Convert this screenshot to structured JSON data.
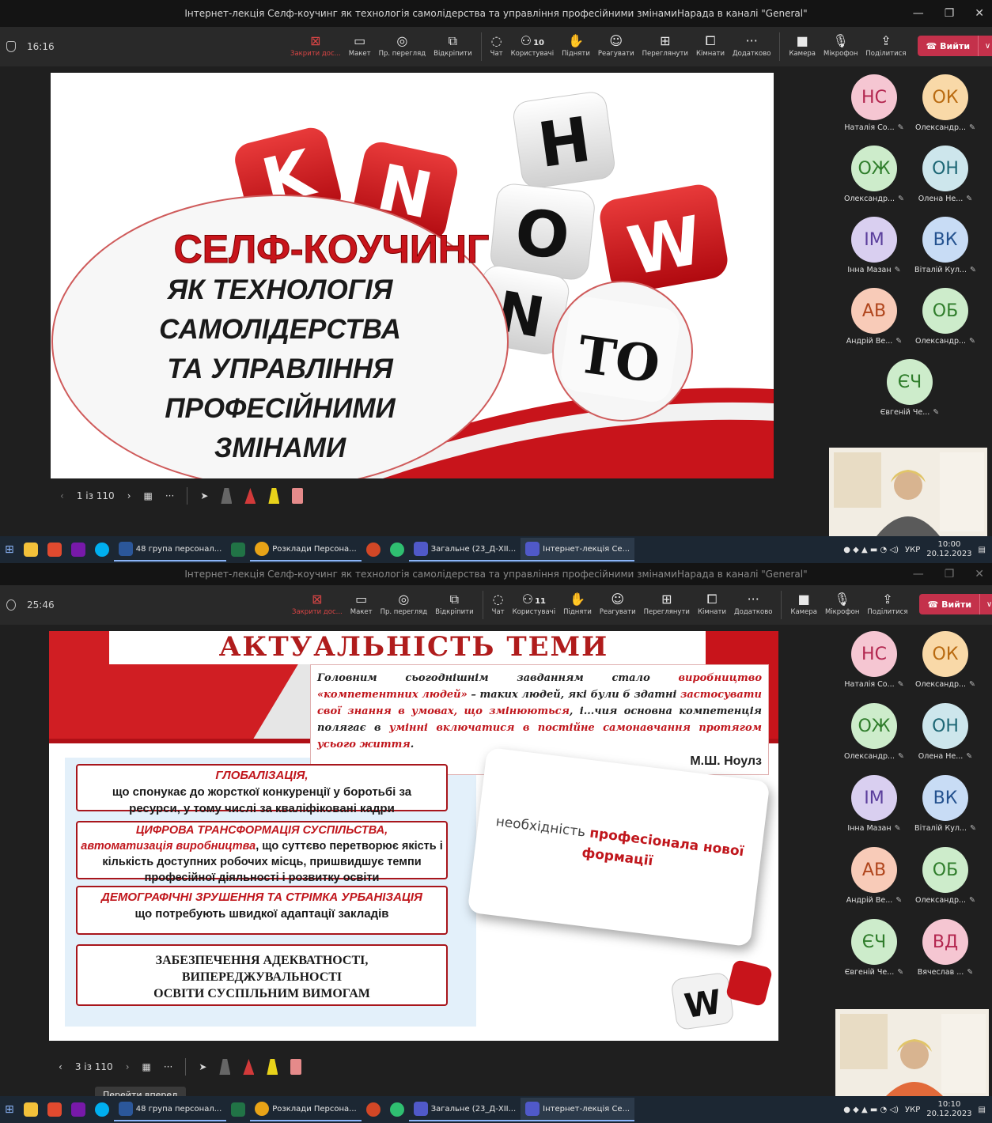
{
  "screens": [
    {
      "window": {
        "title": "Інтернет-лекція Селф-коучинг як технологія самолідерства та управління професійними змінамиНарада в каналі \"General\""
      },
      "meeting": {
        "elapsed": "16:16",
        "toolbar": [
          {
            "label": "Закрити дос...",
            "icon": "close-share-icon",
            "active": true
          },
          {
            "label": "Макет",
            "icon": "layout-icon"
          },
          {
            "label": "Пр. перегляд",
            "icon": "eye-icon"
          },
          {
            "label": "Відкріпити",
            "icon": "popout-icon"
          },
          {
            "label": "Чат",
            "icon": "chat-icon"
          },
          {
            "label": "Користувачі",
            "icon": "people-icon",
            "count": "10"
          },
          {
            "label": "Підняти",
            "icon": "hand-icon"
          },
          {
            "label": "Реагувати",
            "icon": "smile-icon"
          },
          {
            "label": "Переглянути",
            "icon": "view-icon"
          },
          {
            "label": "Кімнати",
            "icon": "rooms-icon"
          },
          {
            "label": "Додатково",
            "icon": "more-icon"
          },
          {
            "label": "Камера",
            "icon": "camera-icon"
          },
          {
            "label": "Мікрофон",
            "icon": "mic-icon"
          },
          {
            "label": "Поділитися",
            "icon": "share-icon"
          }
        ],
        "leave_label": "Вийти",
        "slide_counter": "1 із 110"
      },
      "slide": {
        "dice_letters": [
          "K",
          "N",
          "O",
          "H",
          "O",
          "W",
          "N",
          "TO"
        ],
        "title_red": "СЕЛФ-КОУЧИНГ",
        "title_lines": [
          "ЯК ТЕХНОЛОГІЯ",
          "САМОЛІДЕРСТВА",
          "ТА УПРАВЛІННЯ",
          "ПРОФЕСІЙНИМИ",
          "ЗМІНАМИ"
        ]
      },
      "participants": [
        {
          "initials": "НС",
          "name": "Наталія Со...",
          "bg": "#f5c6d2",
          "fg": "#b3264f"
        },
        {
          "initials": "ОК",
          "name": "Олександр...",
          "bg": "#f9d9a8",
          "fg": "#b96a10"
        },
        {
          "initials": "ОЖ",
          "name": "Олександр...",
          "bg": "#cdeccb",
          "fg": "#2f7d2b"
        },
        {
          "initials": "ОН",
          "name": "Олена Не...",
          "bg": "#cde6ec",
          "fg": "#1d6775"
        },
        {
          "initials": "ІМ",
          "name": "Інна Мазан",
          "bg": "#d9cff0",
          "fg": "#5a3e9c"
        },
        {
          "initials": "ВК",
          "name": "Віталій Кул...",
          "bg": "#c8dcf5",
          "fg": "#24528f"
        },
        {
          "initials": "АВ",
          "name": "Андрій Ве...",
          "bg": "#f8cbb8",
          "fg": "#b0451c"
        },
        {
          "initials": "ОБ",
          "name": "Олександр...",
          "bg": "#cdeccb",
          "fg": "#2f7d2b"
        },
        {
          "initials": "ЄЧ",
          "name": "Євгеній Че...",
          "bg": "#cdeccb",
          "fg": "#2f7d2b"
        }
      ],
      "taskbar": {
        "apps": [
          {
            "label": "48 група персонал...",
            "color": "#2b579a"
          },
          {
            "label": "Розклади Персона...",
            "color": "#e8a317"
          },
          {
            "label": "Загальне (23_Д-ХІІ...",
            "color": "#5059c9"
          },
          {
            "label": "Інтернет-лекція Се...",
            "color": "#5059c9"
          }
        ],
        "lang": "УКР",
        "time": "10:00",
        "date": "20.12.2023"
      }
    },
    {
      "window": {
        "title": "Інтернет-лекція Селф-коучинг як технологія самолідерства та управління професійними змінамиНарада в каналі \"General\""
      },
      "meeting": {
        "elapsed": "25:46",
        "toolbar": [
          {
            "label": "Закрити дос...",
            "icon": "close-share-icon",
            "active": true
          },
          {
            "label": "Макет",
            "icon": "layout-icon"
          },
          {
            "label": "Пр. перегляд",
            "icon": "eye-icon"
          },
          {
            "label": "Відкріпити",
            "icon": "popout-icon"
          },
          {
            "label": "Чат",
            "icon": "chat-icon"
          },
          {
            "label": "Користувачі",
            "icon": "people-icon",
            "count": "11"
          },
          {
            "label": "Підняти",
            "icon": "hand-icon"
          },
          {
            "label": "Реагувати",
            "icon": "smile-icon"
          },
          {
            "label": "Переглянути",
            "icon": "view-icon"
          },
          {
            "label": "Кімнати",
            "icon": "rooms-icon"
          },
          {
            "label": "Додатково",
            "icon": "more-icon"
          },
          {
            "label": "Камера",
            "icon": "camera-icon"
          },
          {
            "label": "Мікрофон",
            "icon": "mic-icon"
          },
          {
            "label": "Поділитися",
            "icon": "share-icon"
          }
        ],
        "leave_label": "Вийти",
        "slide_counter": "3 із 110",
        "tooltip": "Перейти вперед"
      },
      "slide": {
        "title": "АКТУАЛЬНІСТЬ  ТЕМИ",
        "quote_parts": [
          {
            "t": "Головним сьогоднішнім завданням стало ",
            "hl": false
          },
          {
            "t": "виробництво «компетентних людей»",
            "hl": true
          },
          {
            "t": " – таких людей, які були б здатні ",
            "hl": false
          },
          {
            "t": "застосувати свої знання в умовах, що змінюються",
            "hl": true
          },
          {
            "t": ", і...чия основна компетенція полягає в ",
            "hl": false
          },
          {
            "t": "умінні включатися в постійне самонавчання протягом усього життя",
            "hl": true
          },
          {
            "t": ".",
            "hl": false
          }
        ],
        "quote_author": "М.Ш. Ноулз",
        "box1_red": "ГЛОБАЛІЗАЦІЯ,",
        "box1_text": "що спонукає до жорсткої конкуренції у боротьбі за ресурси, у тому числі за кваліфіковані кадри",
        "box2_red1": "ЦИФРОВА ТРАНСФОРМАЦІЯ СУСПІЛЬСТВА,",
        "box2_red2": "автоматизація виробництва",
        "box2_text": ", що суттєво перетворює якість і кількість доступних робочих місць, пришвидшує темпи професійної діяльності і розвитку освіти",
        "box3_red": "ДЕМОГРАФІЧНІ ЗРУШЕННЯ ТА СТРІМКА УРБАНІЗАЦІЯ",
        "box3_text": "що потребують швидкої адаптації закладів",
        "box4_lines": [
          "ЗАБЕЗПЕЧЕННЯ АДЕКВАТНОСТІ,",
          "ВИПЕРЕДЖУВАЛЬНОСТІ",
          "ОСВІТИ СУСПІЛЬНИМ ВИМОГАМ"
        ],
        "card_plain": "необхідність ",
        "card_red": "професіонала нової формації",
        "dice_letter": "W"
      },
      "participants": [
        {
          "initials": "НС",
          "name": "Наталія Со...",
          "bg": "#f5c6d2",
          "fg": "#b3264f"
        },
        {
          "initials": "ОК",
          "name": "Олександр...",
          "bg": "#f9d9a8",
          "fg": "#b96a10"
        },
        {
          "initials": "ОЖ",
          "name": "Олександр...",
          "bg": "#cdeccb",
          "fg": "#2f7d2b"
        },
        {
          "initials": "ОН",
          "name": "Олена Не...",
          "bg": "#cde6ec",
          "fg": "#1d6775"
        },
        {
          "initials": "ІМ",
          "name": "Інна Мазан",
          "bg": "#d9cff0",
          "fg": "#5a3e9c"
        },
        {
          "initials": "ВК",
          "name": "Віталій Кул...",
          "bg": "#c8dcf5",
          "fg": "#24528f"
        },
        {
          "initials": "АВ",
          "name": "Андрій Ве...",
          "bg": "#f8cbb8",
          "fg": "#b0451c"
        },
        {
          "initials": "ОБ",
          "name": "Олександр...",
          "bg": "#cdeccb",
          "fg": "#2f7d2b"
        },
        {
          "initials": "ЄЧ",
          "name": "Євгеній Че...",
          "bg": "#cdeccb",
          "fg": "#2f7d2b"
        },
        {
          "initials": "ВД",
          "name": "Вячеслав ...",
          "bg": "#f5c6d2",
          "fg": "#b3264f"
        }
      ],
      "taskbar": {
        "apps": [
          {
            "label": "48 група персонал...",
            "color": "#2b579a"
          },
          {
            "label": "Розклади Персона...",
            "color": "#e8a317"
          },
          {
            "label": "Загальне (23_Д-ХІІ...",
            "color": "#5059c9"
          },
          {
            "label": "Інтернет-лекція Се...",
            "color": "#5059c9"
          }
        ],
        "lang": "УКР",
        "time": "10:10",
        "date": "20.12.2023"
      }
    }
  ]
}
